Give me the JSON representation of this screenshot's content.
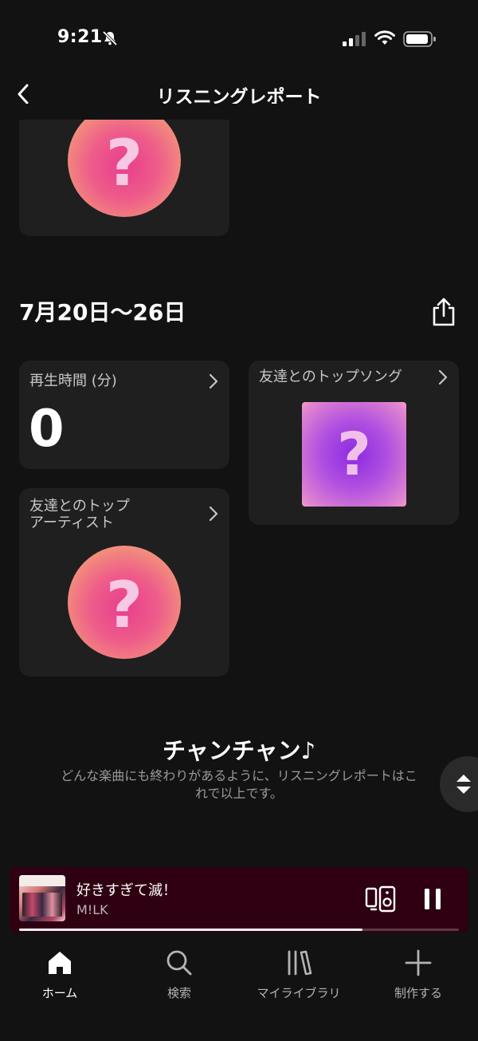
{
  "status_bar": {
    "time": "9:21"
  },
  "header": {
    "title": "リスニングレポート"
  },
  "week": {
    "date_range": "7月20日〜26日"
  },
  "cards": {
    "playtime": {
      "label": "再生時間 (分)",
      "value": "0"
    },
    "top_song": {
      "label": "友達とのトップソング"
    },
    "top_artist": {
      "label_line1": "友達とのトップ",
      "label_line2": "アーティスト"
    }
  },
  "ending": {
    "title": "チャンチャン♪",
    "text": "どんな楽曲にも終わりがあるように、リスニングレポートはこれで以上です。"
  },
  "now_playing": {
    "song": "好きすぎて滅！",
    "artist": "M!LK",
    "progress": 0.78,
    "colors": {
      "background": "#2e0012"
    }
  },
  "tabs": [
    {
      "label": "ホーム",
      "icon": "home-icon",
      "active": true
    },
    {
      "label": "検索",
      "icon": "search-icon",
      "active": false
    },
    {
      "label": "マイライブラリ",
      "icon": "library-icon",
      "active": false
    },
    {
      "label": "制作する",
      "icon": "plus-icon",
      "active": false
    }
  ],
  "placeholder_glyph": "?"
}
